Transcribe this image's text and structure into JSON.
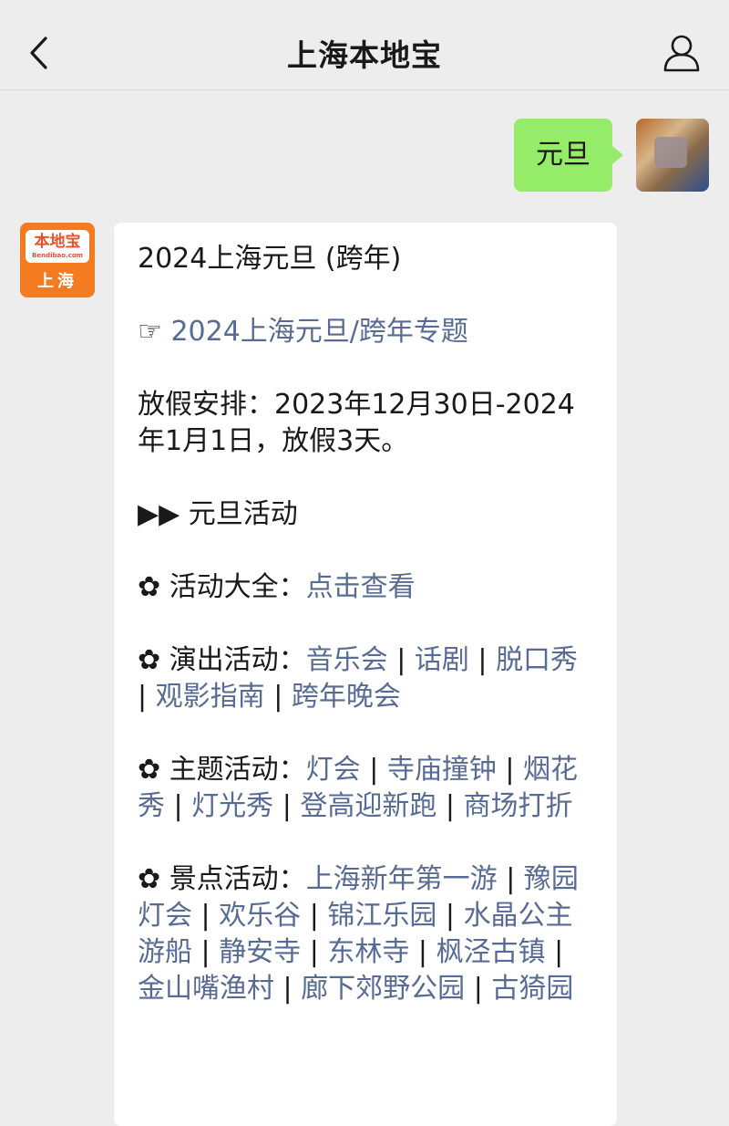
{
  "header": {
    "title": "上海本地宝",
    "back_icon": "chevron-left-icon",
    "profile_icon": "person-icon"
  },
  "outgoing": {
    "text": "元旦"
  },
  "bot": {
    "logo_text": "本地宝",
    "logo_sub": "Bendibao.com",
    "logo_city": "上海"
  },
  "message": {
    "heading": "2024上海元旦 (跨年)",
    "topic_icon": "☞",
    "topic_link": "2024上海元旦/跨年专题",
    "holiday": "放假安排：2023年12月30日-2024年1月1日，放假3天。",
    "section_icon": "▶▶",
    "section_title": "元旦活动",
    "bullet": "✿",
    "groups": [
      {
        "label": "活动大全：",
        "links": [
          "点击查看"
        ]
      },
      {
        "label": "演出活动：",
        "links": [
          "音乐会",
          "话剧",
          "脱口秀",
          "观影指南",
          "跨年晚会"
        ]
      },
      {
        "label": "主题活动：",
        "links": [
          "灯会",
          "寺庙撞钟",
          "烟花秀",
          "灯光秀",
          "登高迎新跑",
          "商场打折"
        ]
      },
      {
        "label": "景点活动：",
        "links": [
          "上海新年第一游",
          "豫园灯会",
          "欢乐谷",
          "锦江乐园",
          "水晶公主游船",
          "静安寺",
          "东林寺",
          "枫泾古镇",
          "金山嘴渔村",
          "廊下郊野公园",
          "古猗园"
        ]
      }
    ]
  },
  "colors": {
    "link": "#576b95",
    "outgoing_bubble": "#95ec69",
    "background": "#ededed"
  }
}
